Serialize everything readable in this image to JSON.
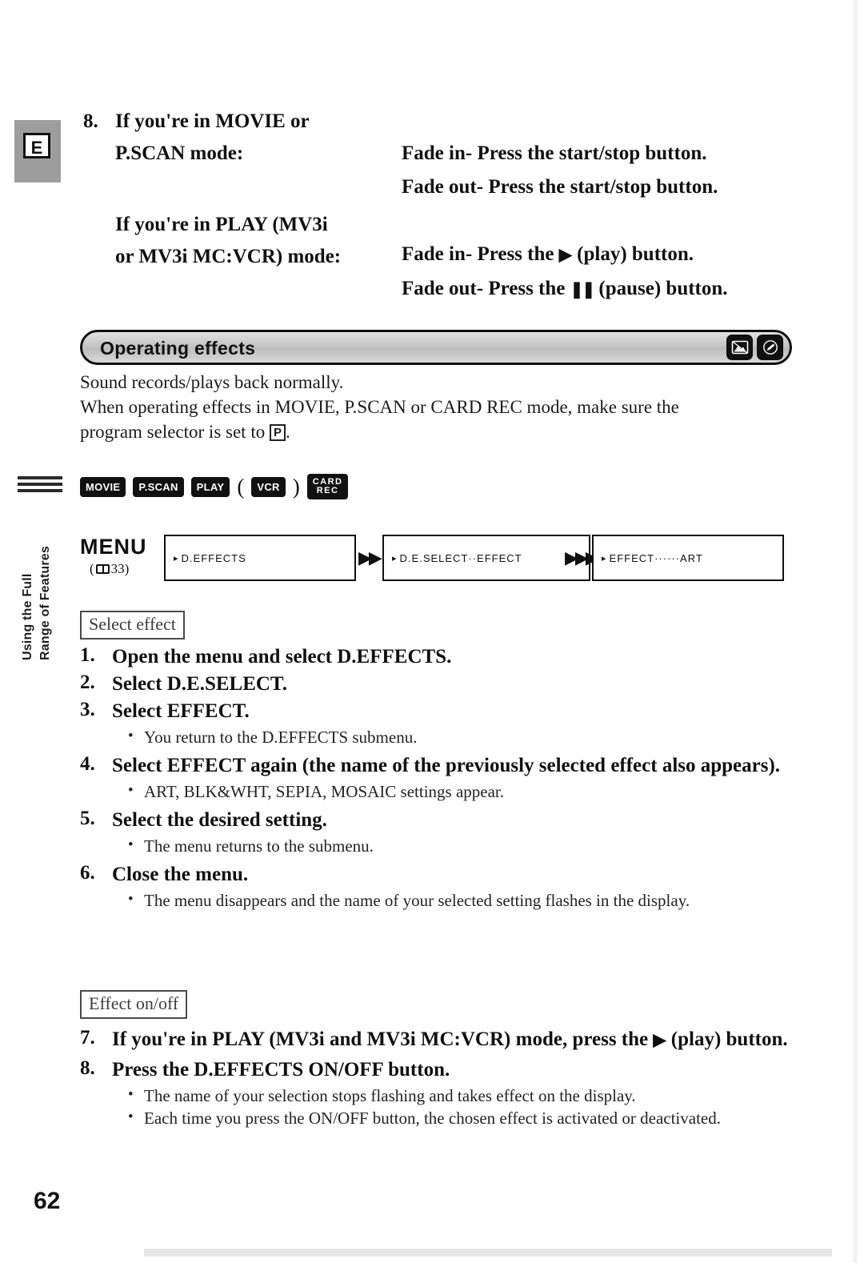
{
  "page": {
    "language_tab": "E",
    "side_text_line1": "Using the Full",
    "side_text_line2": "Range of Features",
    "page_number": "62"
  },
  "top_step": {
    "number": "8.",
    "cond1_line1": "If you're in MOVIE or",
    "cond1_line2": "P.SCAN mode:",
    "cond1_result1": "Fade in- Press the start/stop button.",
    "cond1_result2": "Fade out- Press the start/stop button.",
    "cond2_line1": "If you're in PLAY (MV3i",
    "cond2_line2": "or MV3i MC:VCR) mode:",
    "cond2_result1_pre": "Fade in- Press the",
    "cond2_result1_icon": "▶",
    "cond2_result1_post": "(play) button.",
    "cond2_result2_pre": "Fade out- Press the",
    "cond2_result2_icon": "❚❚",
    "cond2_result2_post": "(pause) button."
  },
  "section": {
    "title": "Operating effects",
    "icon1": "card-photo-icon",
    "icon2": "pencil-edit-icon",
    "intro_line1": "Sound records/plays back normally.",
    "intro_line2": "When operating effects in MOVIE, P.SCAN or CARD REC mode, make sure the",
    "intro_line3_pre": "program selector is set to",
    "intro_line3_badge": "P",
    "intro_line3_post": "."
  },
  "modes": {
    "chips": [
      "MOVIE",
      "P.SCAN",
      "PLAY"
    ],
    "paren_open": "(",
    "paren_chip": "VCR",
    "paren_close": ")",
    "card_chip_line1": "CARD",
    "card_chip_line2": "REC"
  },
  "menu_flow": {
    "menu_label": "MENU",
    "menu_ref_open": "(",
    "menu_ref_page": "33)",
    "box1": "D.EFFECTS",
    "box2": "D.E.SELECT··EFFECT",
    "box3": "EFFECT······ART",
    "marker": "▸"
  },
  "subhead_select": "Select effect",
  "subhead_onoff": "Effect on/off",
  "steps_select": [
    {
      "number": "1.",
      "text": "Open the menu and select D.EFFECTS.",
      "bullets": []
    },
    {
      "number": "2.",
      "text": "Select D.E.SELECT.",
      "bullets": []
    },
    {
      "number": "3.",
      "text": "Select EFFECT.",
      "bullets": [
        "You return to the D.EFFECTS submenu."
      ]
    },
    {
      "number": "4.",
      "text": "Select EFFECT again (the name of the previously selected effect also appears).",
      "bullets": [
        "ART, BLK&WHT, SEPIA, MOSAIC settings appear."
      ]
    },
    {
      "number": "5.",
      "text": "Select the desired setting.",
      "bullets": [
        "The menu returns to the submenu."
      ]
    },
    {
      "number": "6.",
      "text": "Close the menu.",
      "bullets": [
        "The menu disappears and the name of your selected setting flashes in the display."
      ]
    }
  ],
  "steps_onoff": [
    {
      "number": "7.",
      "text_pre": "If you're in PLAY (MV3i and MV3i MC:VCR) mode, press the",
      "icon": "▶",
      "text_post": "(play) button.",
      "bullets": []
    },
    {
      "number": "8.",
      "text": "Press the D.EFFECTS ON/OFF button.",
      "bullets": [
        "The name of your selection stops flashing and takes effect on the display.",
        "Each time you press the ON/OFF button, the chosen effect is activated or deactivated."
      ]
    }
  ]
}
